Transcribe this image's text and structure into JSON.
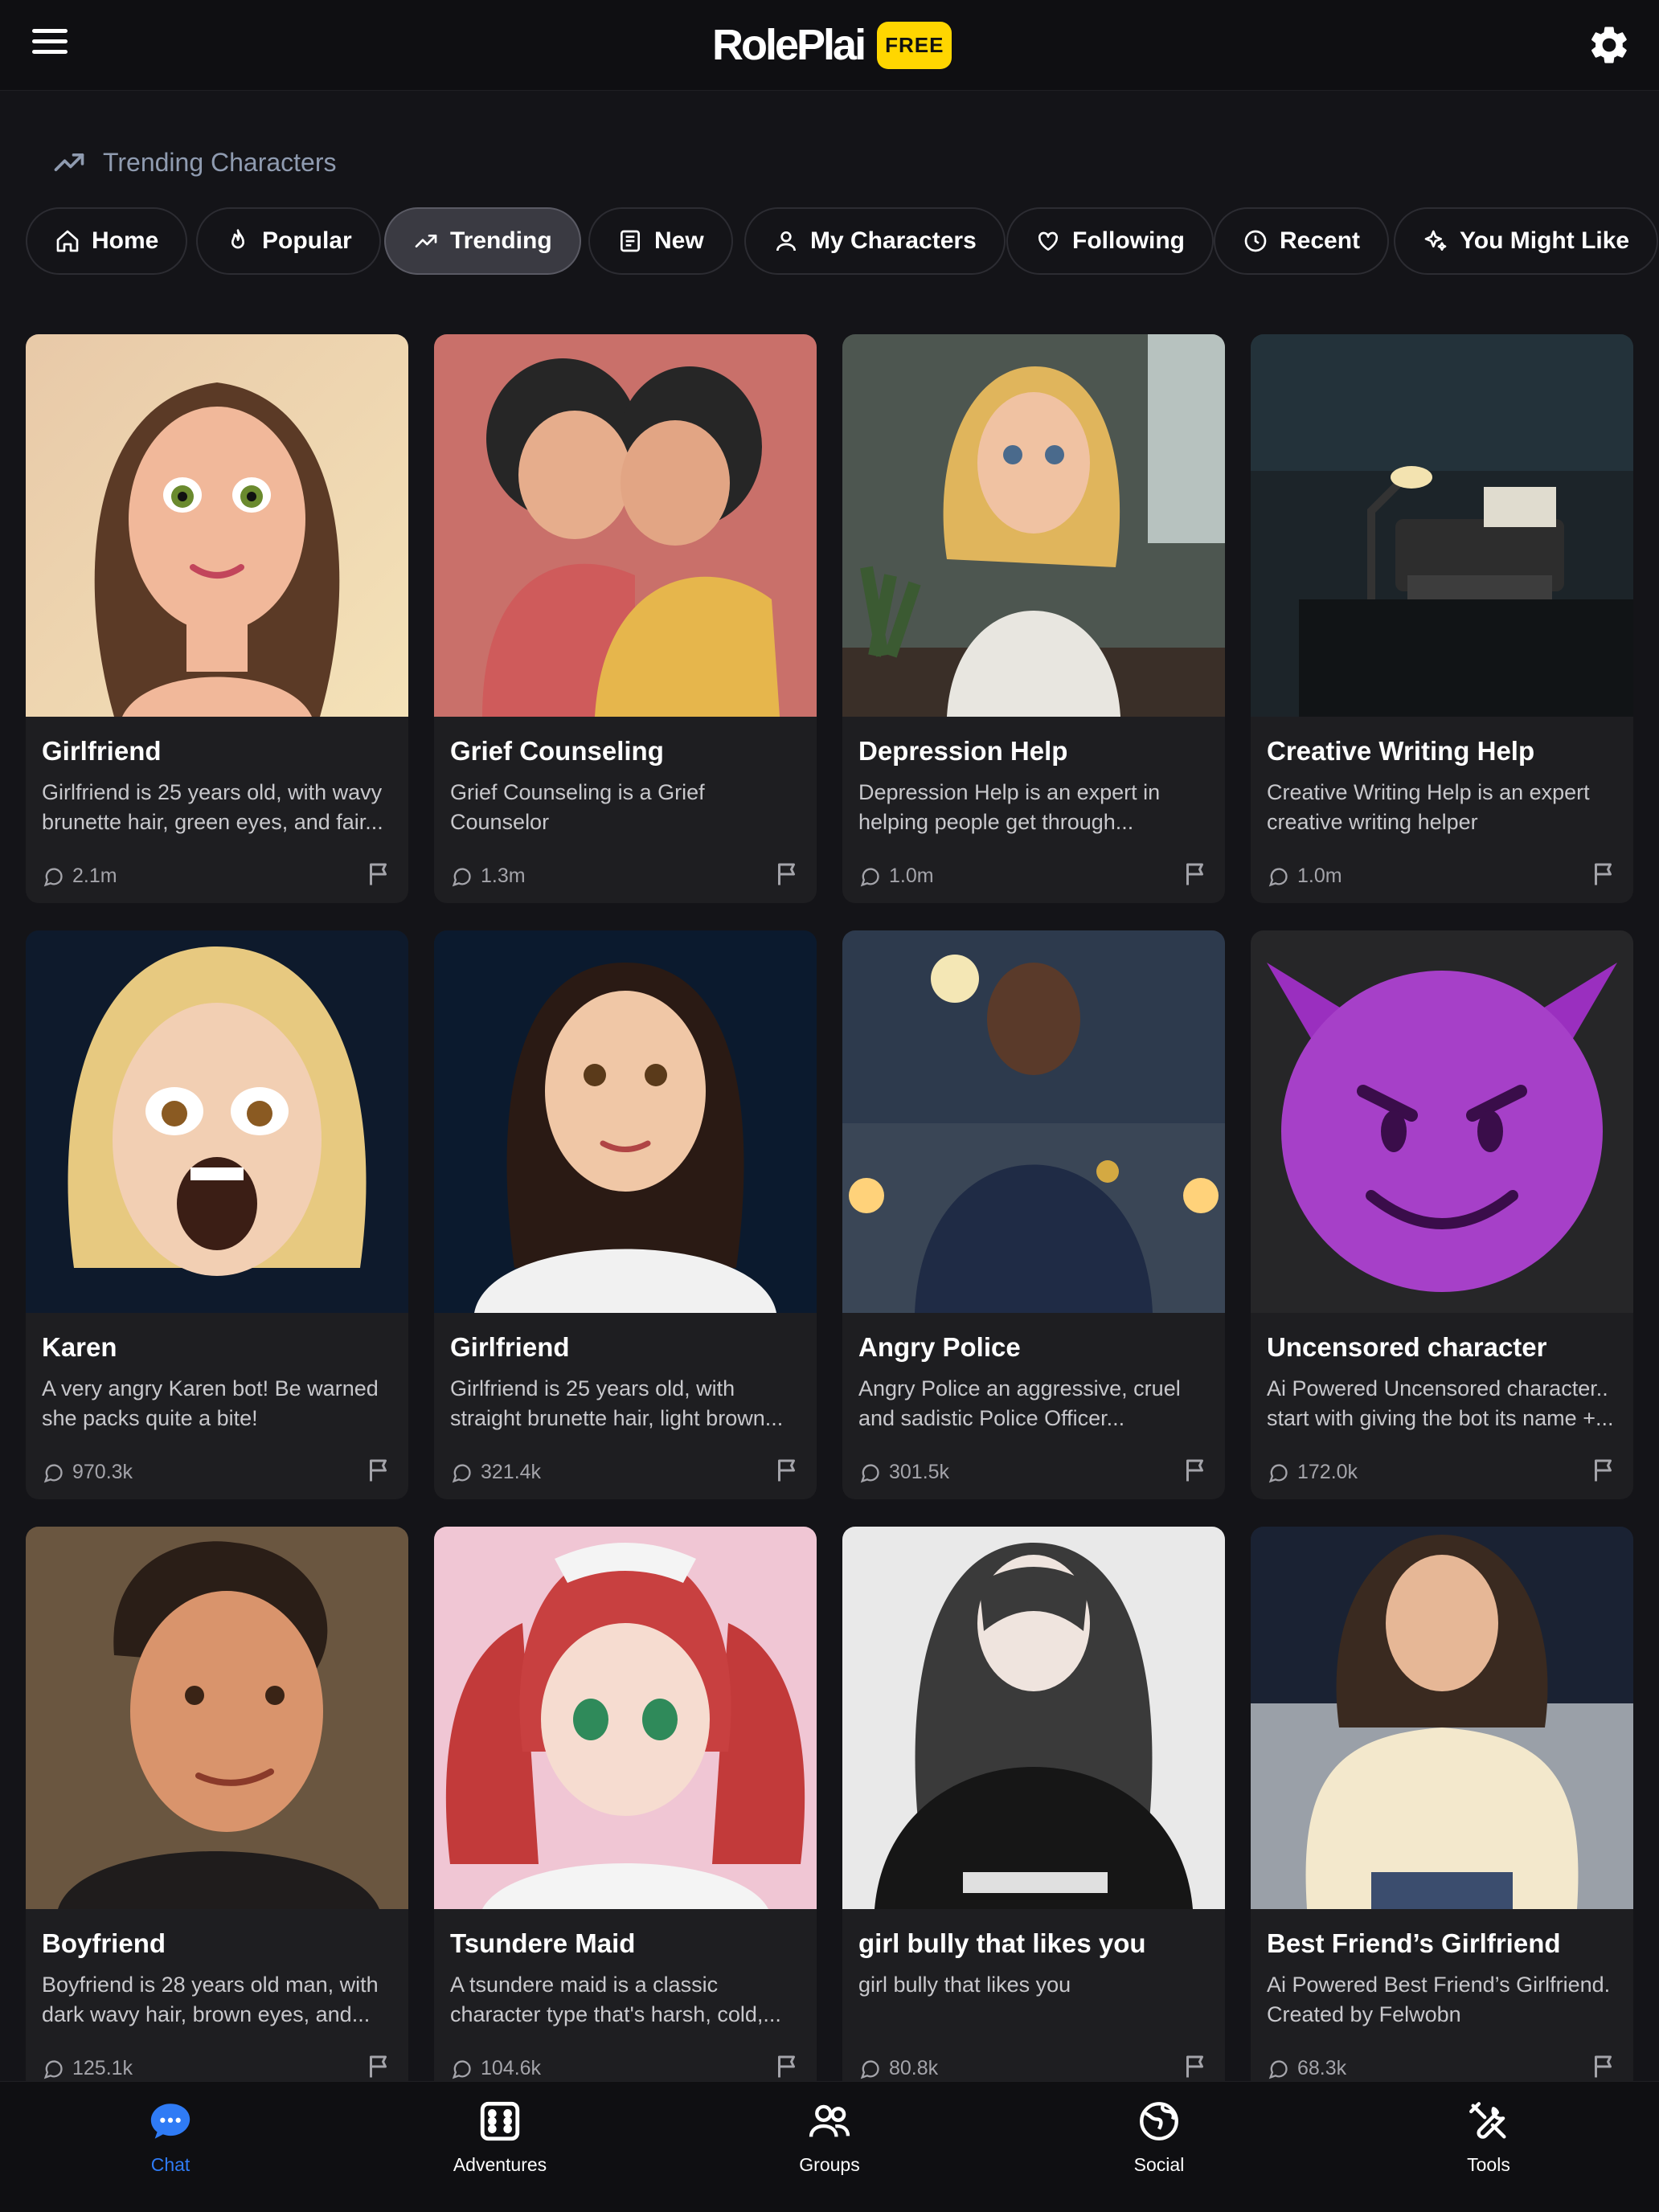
{
  "header": {
    "logo_text": "RolePlai",
    "badge": "FREE"
  },
  "section": {
    "title": "Trending Characters"
  },
  "tabs": [
    {
      "label": "Home",
      "icon": "home-icon"
    },
    {
      "label": "Popular",
      "icon": "flame-icon"
    },
    {
      "label": "Trending",
      "icon": "trending-icon",
      "active": true
    },
    {
      "label": "New",
      "icon": "newspaper-icon"
    },
    {
      "label": "My Characters",
      "icon": "user-icon"
    },
    {
      "label": "Following",
      "icon": "heart-icon"
    },
    {
      "label": "Recent",
      "icon": "clock-icon"
    },
    {
      "label": "You Might Like",
      "icon": "sparkles-icon"
    }
  ],
  "cards": [
    {
      "name": "Girlfriend",
      "desc": "Girlfriend is 25 years old, with wavy brunette hair, green eyes, and fair...",
      "count": "2.1m"
    },
    {
      "name": "Grief Counseling",
      "desc": "Grief Counseling is a Grief Counselor",
      "count": "1.3m"
    },
    {
      "name": "Depression Help",
      "desc": "Depression Help is an expert in helping people get through...",
      "count": "1.0m"
    },
    {
      "name": "Creative Writing Help",
      "desc": "Creative Writing Help is an expert creative writing helper",
      "count": "1.0m"
    },
    {
      "name": "Karen",
      "desc": "A very angry Karen bot! Be warned she packs quite a bite!",
      "count": "970.3k"
    },
    {
      "name": "Girlfriend",
      "desc": "Girlfriend is 25 years old, with straight brunette hair, light brown...",
      "count": "321.4k"
    },
    {
      "name": "Angry Police",
      "desc": "Angry Police an aggressive, cruel and sadistic Police Officer...",
      "count": "301.5k"
    },
    {
      "name": "Uncensored character",
      "desc": "Ai Powered Uncensored character.. start with giving the bot its name +...",
      "count": "172.0k"
    },
    {
      "name": "Boyfriend",
      "desc": "Boyfriend is 28 years old man, with dark wavy hair, brown eyes, and...",
      "count": "125.1k"
    },
    {
      "name": "Tsundere Maid",
      "desc": "A tsundere maid is a classic character type that's harsh, cold,...",
      "count": "104.6k"
    },
    {
      "name": "girl bully that likes you",
      "desc": "girl bully that likes you",
      "count": "80.8k"
    },
    {
      "name": "Best Friend’s Girlfriend",
      "desc": "Ai Powered Best Friend’s Girlfriend. Created by Felwobn",
      "count": "68.3k"
    }
  ],
  "bottom_nav": [
    {
      "label": "Chat",
      "icon": "chat-bubble-icon",
      "active": true
    },
    {
      "label": "Adventures",
      "icon": "dice-icon"
    },
    {
      "label": "Groups",
      "icon": "users-icon"
    },
    {
      "label": "Social",
      "icon": "globe-icon"
    },
    {
      "label": "Tools",
      "icon": "tools-icon"
    }
  ],
  "colors": {
    "accent_blue": "#2f7bf5",
    "badge_yellow": "#ffd600",
    "background": "#141418",
    "card": "#1e1e21"
  }
}
